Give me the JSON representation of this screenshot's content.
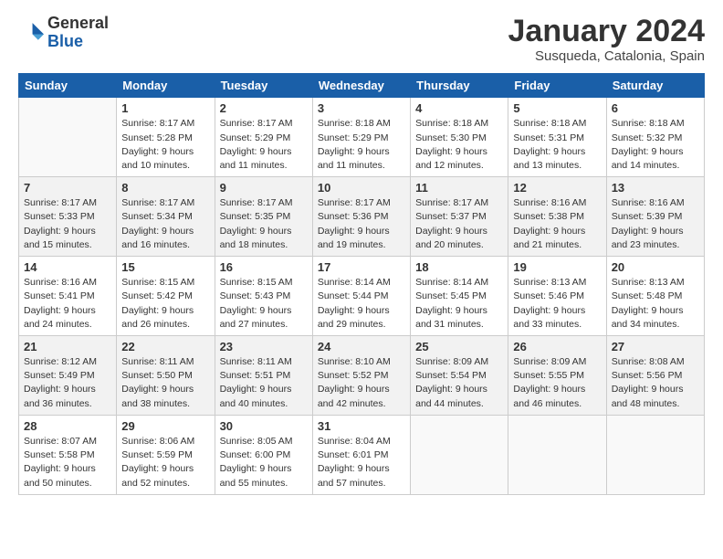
{
  "header": {
    "logo_general": "General",
    "logo_blue": "Blue",
    "month_title": "January 2024",
    "location": "Susqueda, Catalonia, Spain"
  },
  "weekdays": [
    "Sunday",
    "Monday",
    "Tuesday",
    "Wednesday",
    "Thursday",
    "Friday",
    "Saturday"
  ],
  "weeks": [
    [
      {
        "day": "",
        "info": ""
      },
      {
        "day": "1",
        "info": "Sunrise: 8:17 AM\nSunset: 5:28 PM\nDaylight: 9 hours\nand 10 minutes."
      },
      {
        "day": "2",
        "info": "Sunrise: 8:17 AM\nSunset: 5:29 PM\nDaylight: 9 hours\nand 11 minutes."
      },
      {
        "day": "3",
        "info": "Sunrise: 8:18 AM\nSunset: 5:29 PM\nDaylight: 9 hours\nand 11 minutes."
      },
      {
        "day": "4",
        "info": "Sunrise: 8:18 AM\nSunset: 5:30 PM\nDaylight: 9 hours\nand 12 minutes."
      },
      {
        "day": "5",
        "info": "Sunrise: 8:18 AM\nSunset: 5:31 PM\nDaylight: 9 hours\nand 13 minutes."
      },
      {
        "day": "6",
        "info": "Sunrise: 8:18 AM\nSunset: 5:32 PM\nDaylight: 9 hours\nand 14 minutes."
      }
    ],
    [
      {
        "day": "7",
        "info": "Sunrise: 8:17 AM\nSunset: 5:33 PM\nDaylight: 9 hours\nand 15 minutes."
      },
      {
        "day": "8",
        "info": "Sunrise: 8:17 AM\nSunset: 5:34 PM\nDaylight: 9 hours\nand 16 minutes."
      },
      {
        "day": "9",
        "info": "Sunrise: 8:17 AM\nSunset: 5:35 PM\nDaylight: 9 hours\nand 18 minutes."
      },
      {
        "day": "10",
        "info": "Sunrise: 8:17 AM\nSunset: 5:36 PM\nDaylight: 9 hours\nand 19 minutes."
      },
      {
        "day": "11",
        "info": "Sunrise: 8:17 AM\nSunset: 5:37 PM\nDaylight: 9 hours\nand 20 minutes."
      },
      {
        "day": "12",
        "info": "Sunrise: 8:16 AM\nSunset: 5:38 PM\nDaylight: 9 hours\nand 21 minutes."
      },
      {
        "day": "13",
        "info": "Sunrise: 8:16 AM\nSunset: 5:39 PM\nDaylight: 9 hours\nand 23 minutes."
      }
    ],
    [
      {
        "day": "14",
        "info": "Sunrise: 8:16 AM\nSunset: 5:41 PM\nDaylight: 9 hours\nand 24 minutes."
      },
      {
        "day": "15",
        "info": "Sunrise: 8:15 AM\nSunset: 5:42 PM\nDaylight: 9 hours\nand 26 minutes."
      },
      {
        "day": "16",
        "info": "Sunrise: 8:15 AM\nSunset: 5:43 PM\nDaylight: 9 hours\nand 27 minutes."
      },
      {
        "day": "17",
        "info": "Sunrise: 8:14 AM\nSunset: 5:44 PM\nDaylight: 9 hours\nand 29 minutes."
      },
      {
        "day": "18",
        "info": "Sunrise: 8:14 AM\nSunset: 5:45 PM\nDaylight: 9 hours\nand 31 minutes."
      },
      {
        "day": "19",
        "info": "Sunrise: 8:13 AM\nSunset: 5:46 PM\nDaylight: 9 hours\nand 33 minutes."
      },
      {
        "day": "20",
        "info": "Sunrise: 8:13 AM\nSunset: 5:48 PM\nDaylight: 9 hours\nand 34 minutes."
      }
    ],
    [
      {
        "day": "21",
        "info": "Sunrise: 8:12 AM\nSunset: 5:49 PM\nDaylight: 9 hours\nand 36 minutes."
      },
      {
        "day": "22",
        "info": "Sunrise: 8:11 AM\nSunset: 5:50 PM\nDaylight: 9 hours\nand 38 minutes."
      },
      {
        "day": "23",
        "info": "Sunrise: 8:11 AM\nSunset: 5:51 PM\nDaylight: 9 hours\nand 40 minutes."
      },
      {
        "day": "24",
        "info": "Sunrise: 8:10 AM\nSunset: 5:52 PM\nDaylight: 9 hours\nand 42 minutes."
      },
      {
        "day": "25",
        "info": "Sunrise: 8:09 AM\nSunset: 5:54 PM\nDaylight: 9 hours\nand 44 minutes."
      },
      {
        "day": "26",
        "info": "Sunrise: 8:09 AM\nSunset: 5:55 PM\nDaylight: 9 hours\nand 46 minutes."
      },
      {
        "day": "27",
        "info": "Sunrise: 8:08 AM\nSunset: 5:56 PM\nDaylight: 9 hours\nand 48 minutes."
      }
    ],
    [
      {
        "day": "28",
        "info": "Sunrise: 8:07 AM\nSunset: 5:58 PM\nDaylight: 9 hours\nand 50 minutes."
      },
      {
        "day": "29",
        "info": "Sunrise: 8:06 AM\nSunset: 5:59 PM\nDaylight: 9 hours\nand 52 minutes."
      },
      {
        "day": "30",
        "info": "Sunrise: 8:05 AM\nSunset: 6:00 PM\nDaylight: 9 hours\nand 55 minutes."
      },
      {
        "day": "31",
        "info": "Sunrise: 8:04 AM\nSunset: 6:01 PM\nDaylight: 9 hours\nand 57 minutes."
      },
      {
        "day": "",
        "info": ""
      },
      {
        "day": "",
        "info": ""
      },
      {
        "day": "",
        "info": ""
      }
    ]
  ]
}
